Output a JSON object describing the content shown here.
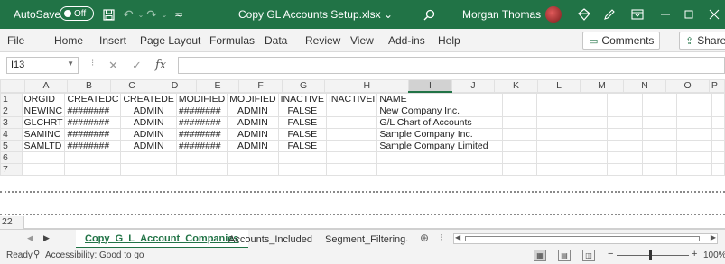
{
  "titlebar": {
    "autosave_label": "AutoSave",
    "autosave_state": "Off",
    "filename": "Copy GL Accounts Setup.xlsx",
    "filename_caret": "⌄",
    "username": "Morgan Thomas"
  },
  "menu": {
    "items": [
      "File",
      "Home",
      "Insert",
      "Page Layout",
      "Formulas",
      "Data",
      "Review",
      "View",
      "Add-ins",
      "Help"
    ],
    "comments_label": "Comments",
    "share_label": "Share"
  },
  "formula_bar": {
    "cell_ref": "I13",
    "fx_symbol": "fx",
    "cancel_symbol": "✕",
    "enter_symbol": "✓",
    "value": ""
  },
  "grid": {
    "columns": [
      "A",
      "B",
      "C",
      "D",
      "E",
      "F",
      "G",
      "H",
      "I",
      "J",
      "K",
      "L",
      "M",
      "N",
      "O",
      "P"
    ],
    "selected_column": "I",
    "rows": [
      {
        "num": "1",
        "cells": [
          "ORGID",
          "CREATEDC",
          "CREATEDE",
          "MODIFIED",
          "MODIFIED",
          "INACTIVE",
          "INACTIVEI",
          "NAME"
        ]
      },
      {
        "num": "2",
        "cells": [
          "NEWINC",
          "########",
          "ADMIN",
          "########",
          "ADMIN",
          "FALSE",
          "",
          "New Company Inc."
        ]
      },
      {
        "num": "3",
        "cells": [
          "GLCHRT",
          "########",
          "ADMIN",
          "########",
          "ADMIN",
          "FALSE",
          "",
          "G/L Chart of Accounts"
        ]
      },
      {
        "num": "4",
        "cells": [
          "SAMINC",
          "########",
          "ADMIN",
          "########",
          "ADMIN",
          "FALSE",
          "",
          "Sample Company Inc."
        ]
      },
      {
        "num": "5",
        "cells": [
          "SAMLTD",
          "########",
          "ADMIN",
          "########",
          "ADMIN",
          "FALSE",
          "",
          "Sample Company Limited"
        ]
      },
      {
        "num": "6",
        "cells": [
          "",
          "",
          "",
          "",
          "",
          "",
          "",
          ""
        ]
      },
      {
        "num": "7",
        "cells": [
          "",
          "",
          "",
          "",
          "",
          "",
          "",
          ""
        ]
      }
    ],
    "frozen_row": "22"
  },
  "sheet_tabs": {
    "tabs": [
      "Copy_G_L_Account_Companies",
      "Accounts_Included",
      "Segment_Filtering"
    ],
    "active": "Copy_G_L_Account_Companies",
    "more": "...",
    "add": "⊕"
  },
  "statusbar": {
    "ready": "Ready",
    "accessibility": "Accessibility: Good to go",
    "zoom": "100%"
  },
  "colors": {
    "accent": "#217346"
  }
}
